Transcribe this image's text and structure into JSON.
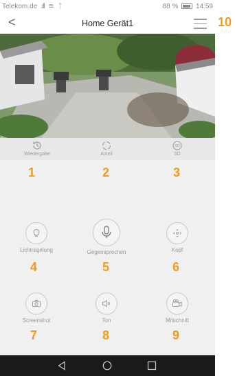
{
  "status": {
    "carrier": "Telekom.de",
    "battery": "88 %",
    "time": "14:59"
  },
  "header": {
    "title": "Home Gerät1"
  },
  "tabs": [
    {
      "label": "Wiedergabe",
      "icon": "history-icon"
    },
    {
      "label": "Anteil",
      "icon": "share-icon"
    },
    {
      "label": "SD",
      "icon": "sd-card-icon"
    }
  ],
  "controls": [
    {
      "label": "Lichtregelung",
      "icon": "light-bulb-icon"
    },
    {
      "label": "Gegensprechen",
      "icon": "microphone-icon"
    },
    {
      "label": "Kopf",
      "icon": "pan-tilt-icon"
    },
    {
      "label": "Screenshot",
      "icon": "camera-icon"
    },
    {
      "label": "Ton",
      "icon": "speaker-mute-icon"
    },
    {
      "label": "Mitschnitt",
      "icon": "video-camera-icon"
    }
  ],
  "annotations": [
    "1",
    "2",
    "3",
    "4",
    "5",
    "6",
    "7",
    "8",
    "9",
    "10"
  ],
  "colors": {
    "annotation": "#f39a1e",
    "sysbar": "#1a1a1a"
  }
}
